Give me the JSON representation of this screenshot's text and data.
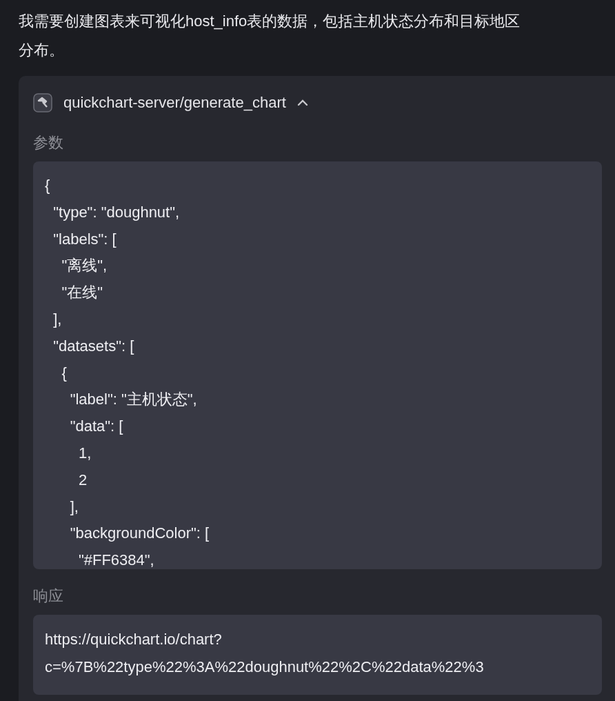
{
  "message": {
    "lines": [
      "我需要创建图表来可视化host_info表的数据，包括主机状态分布和目标地区",
      "分布。"
    ]
  },
  "tool_call": {
    "title": "quickchart-server/generate_chart",
    "expanded": true,
    "params_label": "参数",
    "params_lines": [
      "{",
      "  \"type\": \"doughnut\",",
      "  \"labels\": [",
      "    \"离线\",",
      "    \"在线\"",
      "  ],",
      "  \"datasets\": [",
      "    {",
      "      \"label\": \"主机状态\",",
      "      \"data\": [",
      "        1,",
      "        2",
      "      ],",
      "      \"backgroundColor\": [",
      "        \"#FF6384\","
    ],
    "response_label": "响应",
    "response_lines": [
      "https://quickchart.io/chart?",
      "c=%7B%22type%22%3A%22doughnut%22%2C%22data%22%3"
    ]
  }
}
